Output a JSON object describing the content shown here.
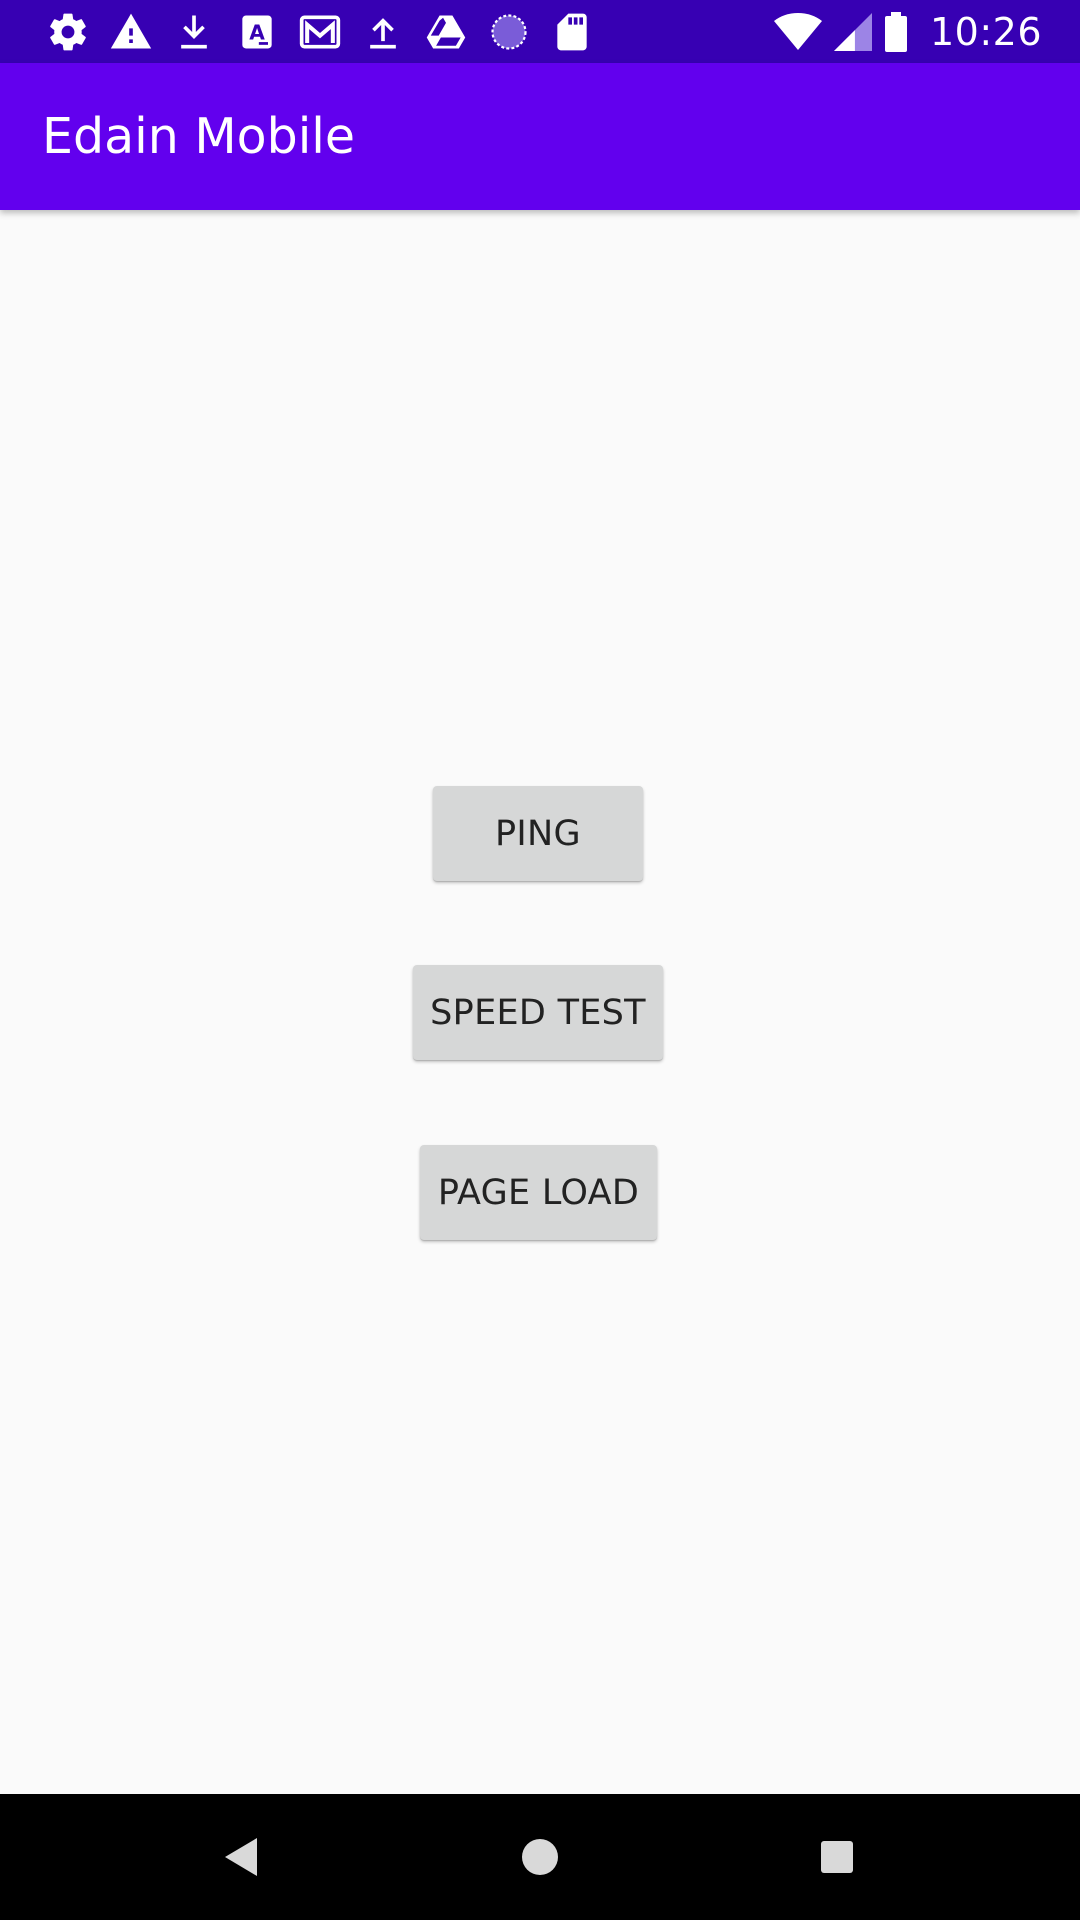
{
  "status_bar": {
    "time": "10:26",
    "left_icons": [
      "gear-icon",
      "warning-icon",
      "download-icon",
      "app-a-icon",
      "gmail-icon",
      "upload-icon",
      "drive-icon",
      "sync-circle-icon",
      "sd-card-icon"
    ],
    "right_icons": [
      "wifi-icon",
      "cell-signal-icon",
      "battery-icon"
    ]
  },
  "app_bar": {
    "title": "Edain Mobile"
  },
  "buttons": {
    "ping": "PING",
    "speed_test": "SPEED TEST",
    "page_load": "PAGE LOAD"
  },
  "nav_bar": {
    "items": [
      "back-icon",
      "home-icon",
      "recents-icon"
    ]
  },
  "colors": {
    "status_bar": "#3700b3",
    "app_bar": "#6200ee",
    "background": "#fafafa",
    "button": "#d6d7d7",
    "button_text": "#222222",
    "nav_bar": "#000000"
  }
}
